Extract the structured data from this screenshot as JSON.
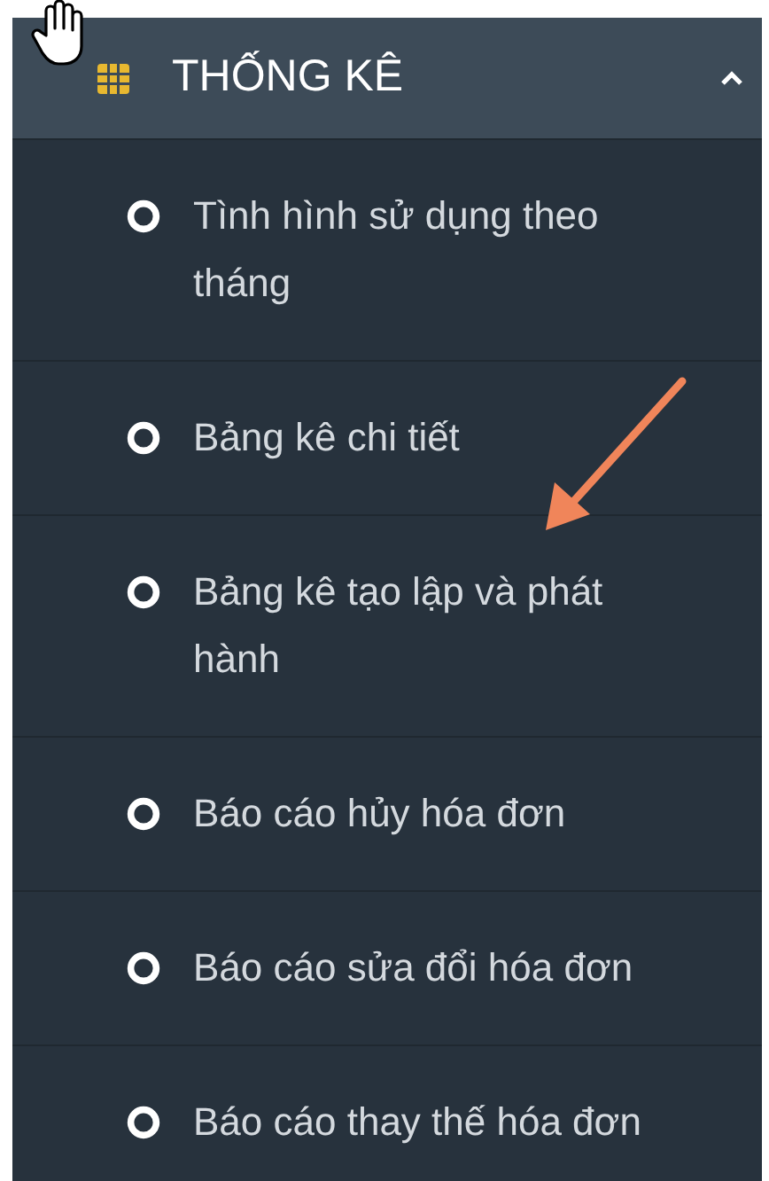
{
  "menu_header": {
    "title": "THỐNG KÊ",
    "expanded": true
  },
  "items": [
    {
      "label": "Tình hình sử dụng theo tháng"
    },
    {
      "label": "Bảng kê chi tiết"
    },
    {
      "label": "Bảng kê tạo lập và phát hành"
    },
    {
      "label": "Báo cáo hủy hóa đơn"
    },
    {
      "label": "Báo cáo sửa đổi hóa đơn"
    },
    {
      "label": "Báo cáo thay thế hóa đơn"
    }
  ]
}
